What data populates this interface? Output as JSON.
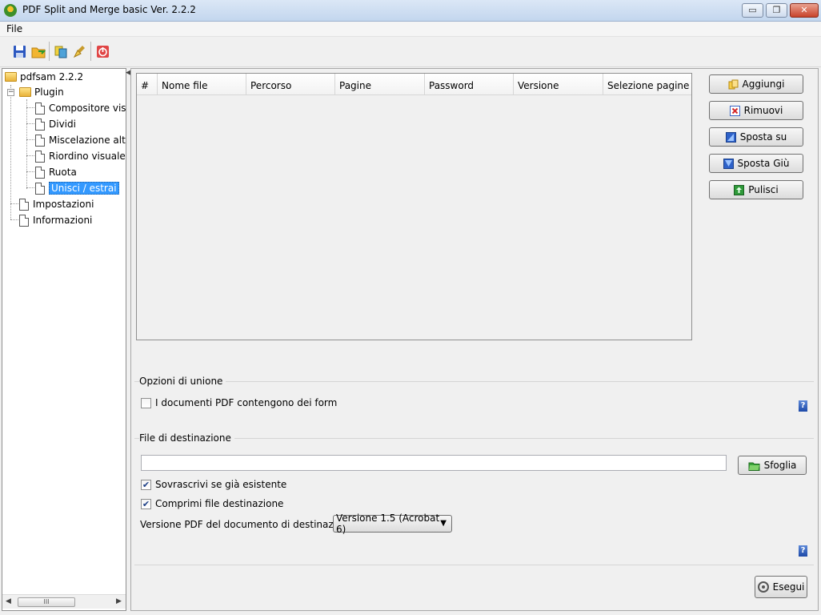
{
  "window": {
    "title": "PDF Split and Merge basic Ver. 2.2.2",
    "min_label": "▭",
    "max_label": "❐",
    "close_label": "✕"
  },
  "menu": {
    "file": "File"
  },
  "toolbar": {
    "icons": [
      "save-icon",
      "open-icon",
      "tile-icon",
      "clear-icon",
      "exit-icon"
    ]
  },
  "tree": {
    "root": "pdfsam 2.2.2",
    "plugin": "Plugin",
    "plugins": [
      "Compositore visu",
      "Dividi",
      "Miscelazione alter",
      "Riordino visuale",
      "Ruota",
      "Unisci / estrai"
    ],
    "settings": "Impostazioni",
    "info": "Informazioni",
    "scroll_thumb": "III"
  },
  "table": {
    "columns": [
      "#",
      "Nome file",
      "Percorso",
      "Pagine",
      "Password",
      "Versione",
      "Selezione pagine"
    ]
  },
  "buttons": {
    "add": "Aggiungi",
    "remove": "Rimuovi",
    "move_up": "Sposta su",
    "move_down": "Sposta Giù",
    "clear": "Pulisci",
    "browse": "Sfoglia",
    "run": "Esegui"
  },
  "merge_options": {
    "label": "Opzioni di unione",
    "forms_checkbox": "I documenti PDF contengono dei form",
    "forms_checked": false
  },
  "destination": {
    "label": "File di destinazione",
    "path_value": "",
    "overwrite": "Sovrascrivi se già esistente",
    "overwrite_checked": true,
    "compress": "Comprimi file destinazione",
    "compress_checked": true,
    "version_label": "Versione PDF del documento di destinazione:",
    "version_selected": "Versione 1.5 (Acrobat 6)"
  },
  "help": "?",
  "colors": {
    "selection": "#3399ff",
    "accent_blue": "#1d4aa8",
    "title_gradient_top": "#dbe7f6"
  }
}
